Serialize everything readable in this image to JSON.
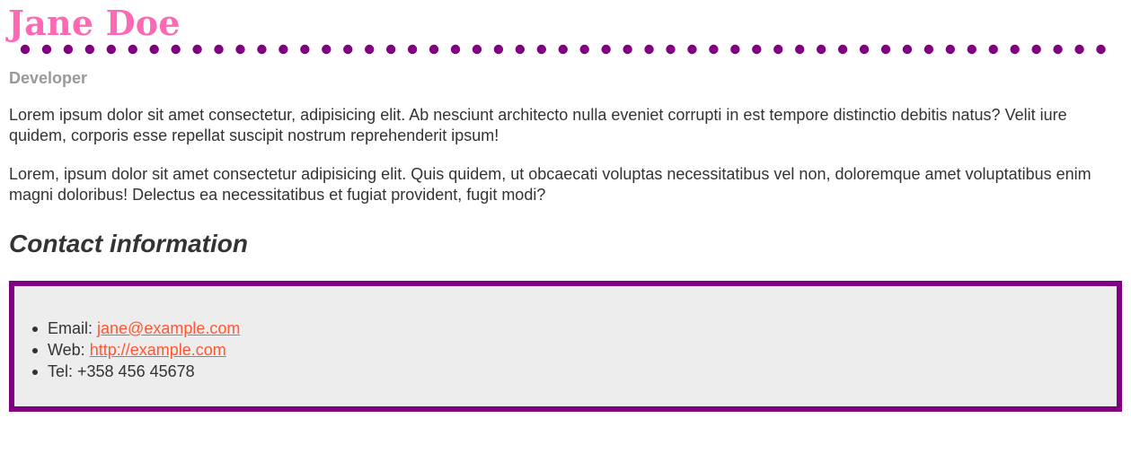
{
  "header": {
    "name": "Jane Doe",
    "role": "Developer"
  },
  "bio": {
    "paragraphs": [
      "Lorem ipsum dolor sit amet consectetur, adipisicing elit. Ab nesciunt architecto nulla eveniet corrupti in est tempore distinctio debitis natus? Velit iure quidem, corporis esse repellat suscipit nostrum reprehenderit ipsum!",
      "Lorem, ipsum dolor sit amet consectetur adipisicing elit. Quis quidem, ut obcaecati voluptas necessitatibus vel non, doloremque amet voluptatibus enim magni doloribus! Delectus ea necessitatibus et fugiat provident, fugit modi?"
    ]
  },
  "contact": {
    "heading": "Contact information",
    "email_label": "Email: ",
    "email_value": "jane@example.com",
    "web_label": "Web: ",
    "web_value": "http://example.com",
    "tel_label": "Tel: ",
    "tel_value": "+358 456 45678"
  },
  "colors": {
    "name": "#ff69b4",
    "divider_dots": "#800080",
    "role": "#999999",
    "body_text": "#333333",
    "box_border": "#800080",
    "box_background": "#ededed",
    "link": "#ff5733"
  }
}
